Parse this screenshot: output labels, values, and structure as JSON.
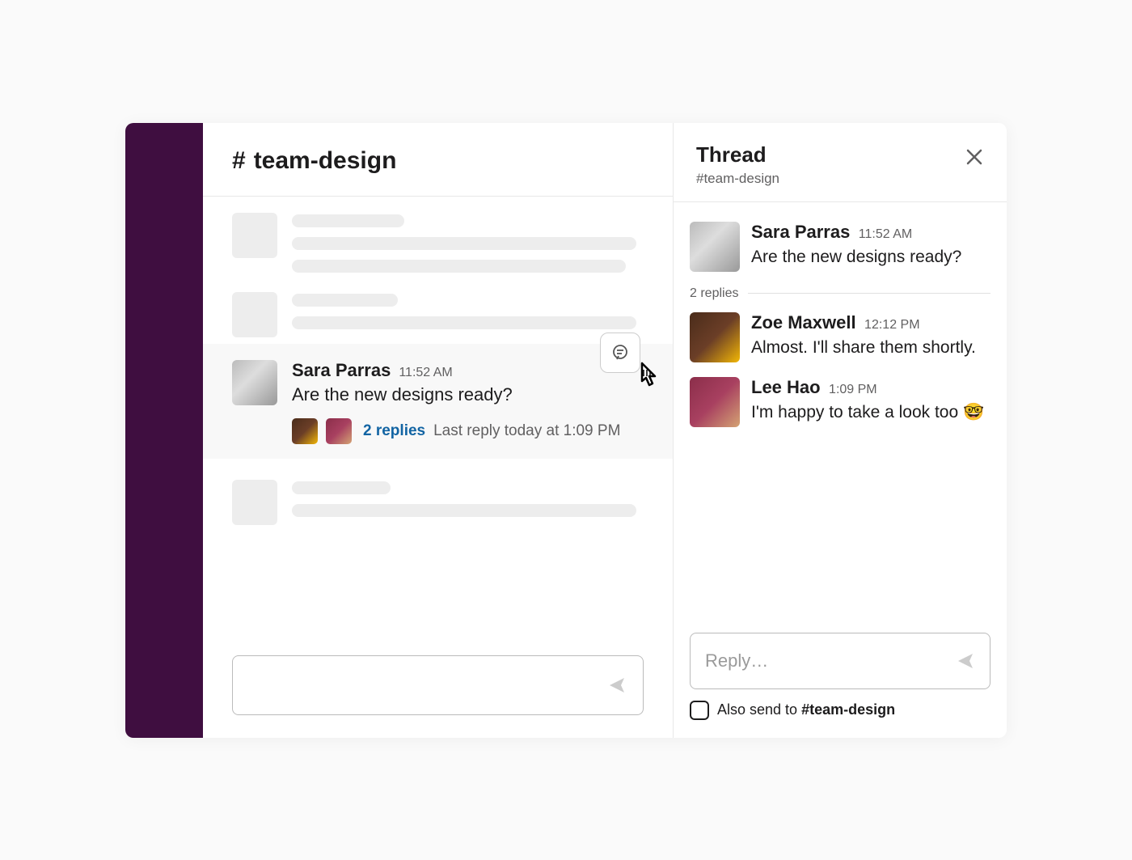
{
  "channel": {
    "hash": "#",
    "name": "team-design"
  },
  "message": {
    "author": "Sara Parras",
    "time": "11:52 AM",
    "text": "Are the new designs ready?",
    "replies_label": "2 replies",
    "last_reply": "Last reply today at 1:09 PM"
  },
  "thread": {
    "title": "Thread",
    "subtitle": "#team-design",
    "replies_count": "2 replies",
    "root": {
      "author": "Sara Parras",
      "time": "11:52 AM",
      "text": "Are the new designs ready?"
    },
    "replies": [
      {
        "author": "Zoe Maxwell",
        "time": "12:12 PM",
        "text": "Almost. I'll share them shortly."
      },
      {
        "author": "Lee Hao",
        "time": "1:09 PM",
        "text": "I'm happy to take a look too 🤓"
      }
    ],
    "composer_placeholder": "Reply…",
    "also_send_prefix": "Also send to ",
    "also_send_channel": "#team-design"
  }
}
